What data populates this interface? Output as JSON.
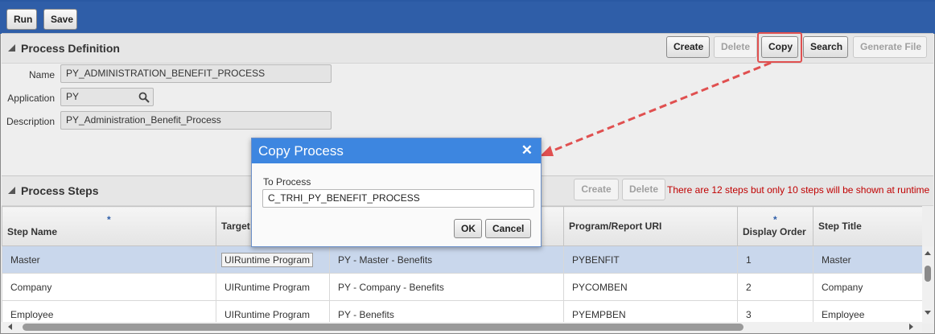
{
  "toolbar": {
    "run_label": "Run",
    "save_label": "Save"
  },
  "process_definition": {
    "title": "Process Definition",
    "buttons": {
      "create": "Create",
      "delete": "Delete",
      "copy": "Copy",
      "search": "Search",
      "generate_file": "Generate File"
    },
    "name_label": "Name",
    "name_value": "PY_ADMINISTRATION_BENEFIT_PROCESS",
    "application_label": "Application",
    "application_value": "PY",
    "description_label": "Description",
    "description_value": "PY_Administration_Benefit_Process"
  },
  "process_steps": {
    "title": "Process Steps",
    "buttons": {
      "create": "Create",
      "delete": "Delete"
    },
    "warning": "There are 12 steps but only 10 steps will be shown at runtime",
    "columns": [
      "Step Name",
      "Target",
      "",
      "Program/Report URI",
      "Display Order",
      "Step Title"
    ],
    "rows": [
      {
        "step_name": "Master",
        "target": "UIRuntime Program",
        "program": "PY - Master - Benefits",
        "uri": "PYBENFIT",
        "order": "1",
        "title": "Master"
      },
      {
        "step_name": "Company",
        "target": "UIRuntime Program",
        "program": "PY - Company - Benefits",
        "uri": "PYCOMBEN",
        "order": "2",
        "title": "Company"
      },
      {
        "step_name": "Employee",
        "target": "UIRuntime Program",
        "program": "PY - Benefits",
        "uri": "PYEMPBEN",
        "order": "3",
        "title": "Employee"
      }
    ]
  },
  "copy_dialog": {
    "title": "Copy Process",
    "close_symbol": "✕",
    "to_process_label": "To Process",
    "to_process_value": "C_TRHI_PY_BENEFIT_PROCESS",
    "ok_label": "OK",
    "cancel_label": "Cancel"
  },
  "icons": {
    "search": "search-icon",
    "close": "close-icon",
    "collapse": "collapse-triangle-icon"
  },
  "colors": {
    "toolbar": "#2f5ea8",
    "dialog_header": "#3d86e0",
    "highlight": "#e05050",
    "selected_row": "#c9d7ec",
    "warning": "#c00000"
  }
}
